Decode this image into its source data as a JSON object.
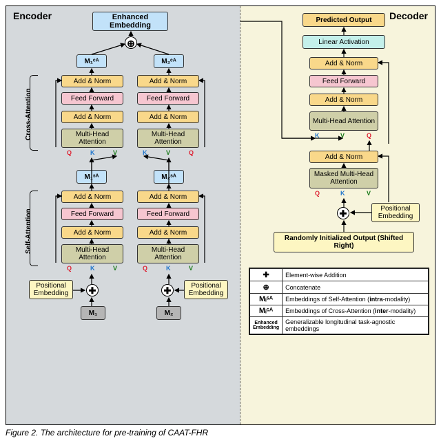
{
  "caption": "Figure 2. The architecture for pre-training of CAAT-FHR",
  "encoder": {
    "title": "Encoder",
    "enhanced": "Enhanced Embedding",
    "m1ca": "M₁ᶜᴬ",
    "m2ca": "M₂ᶜᴬ",
    "m1sa": "M₁ˢᴬ",
    "m2sa": "M₂ˢᴬ",
    "addnorm": "Add & Norm",
    "ff": "Feed Forward",
    "mha": "Multi-Head Attention",
    "posem": "Positional Embedding",
    "m1": "M₁",
    "m2": "M₂",
    "cross_label": "Cross-Attention",
    "self_label": "Self-Attention",
    "q": "Q",
    "k": "K",
    "v": "V"
  },
  "decoder": {
    "title": "Decoder",
    "pred": "Predicted Output",
    "linact": "Linear Activation",
    "addnorm": "Add & Norm",
    "ff": "Feed Forward",
    "mha": "Multi-Head Attention",
    "mmha": "Masked Multi-Head Attention",
    "posem": "Positional Embedding",
    "rand": "Randomly Initialized Output (Shifted Right)",
    "q": "Q",
    "k": "K",
    "v": "V"
  },
  "legend": {
    "plus_sym": "✚",
    "plus_txt": "Element-wise Addition",
    "concat_sym": "⊕",
    "concat_txt": "Concatenate",
    "misa_sym": "Mᵢˢᴬ",
    "misa_txt": "Embeddings of Self-Attention (intra-modality)",
    "mica_sym": "Mᵢᶜᴬ",
    "mica_txt": "Embeddings of Cross-Attention (inter-modality)",
    "enh_sym": "Enhanced Embedding",
    "enh_txt": "Generalizable longitudinal task-agnostic embeddings"
  }
}
